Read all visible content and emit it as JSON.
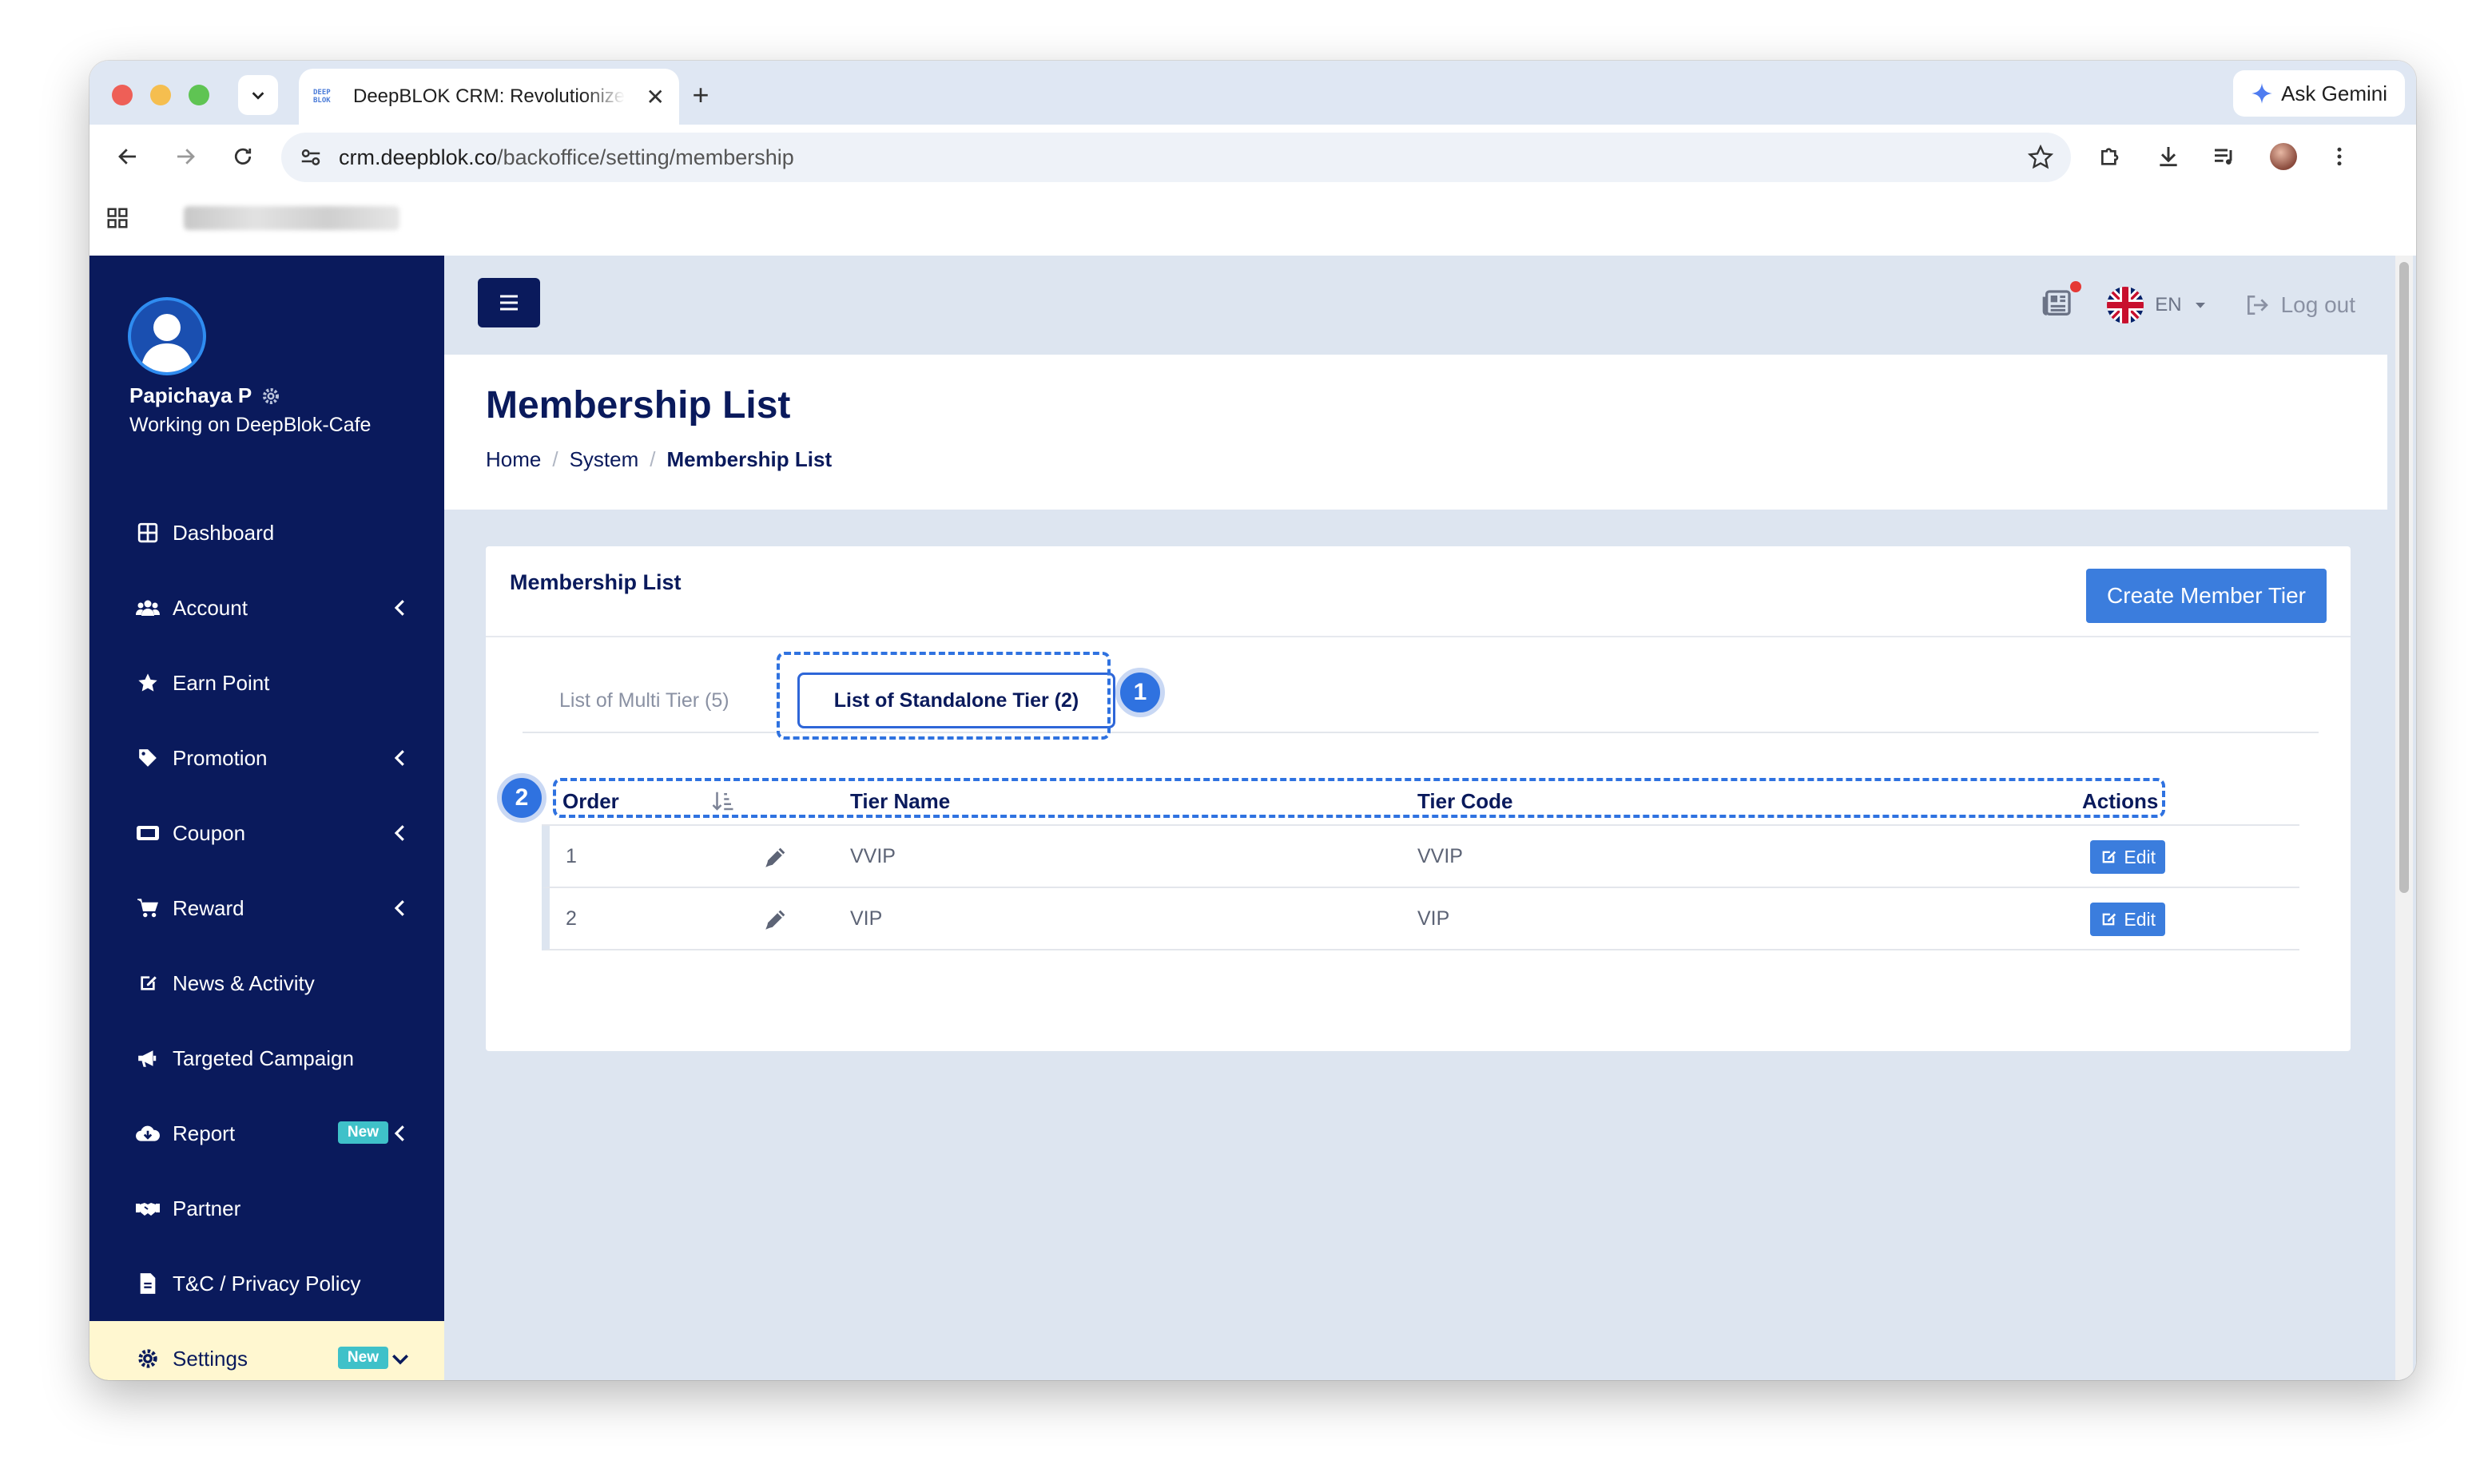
{
  "browser": {
    "tab_title": "DeepBLOK CRM: Revolutionize",
    "favicon_text_1": "DEEP",
    "favicon_text_2": "BLOK",
    "ask_gemini": "Ask Gemini",
    "url_host": "crm.deepblok.co",
    "url_path": "/backoffice/setting/membership"
  },
  "sidebar": {
    "user_name": "Papichaya P",
    "user_sub": "Working on DeepBlok-Cafe",
    "items": [
      {
        "label": "Dashboard",
        "icon": "dashboard-icon",
        "chevron": false
      },
      {
        "label": "Account",
        "icon": "users-icon",
        "chevron": true
      },
      {
        "label": "Earn Point",
        "icon": "star-icon",
        "chevron": false
      },
      {
        "label": "Promotion",
        "icon": "tag-icon",
        "chevron": true
      },
      {
        "label": "Coupon",
        "icon": "ticket-icon",
        "chevron": true
      },
      {
        "label": "Reward",
        "icon": "cart-icon",
        "chevron": true
      },
      {
        "label": "News & Activity",
        "icon": "edit-icon",
        "chevron": false
      },
      {
        "label": "Targeted Campaign",
        "icon": "megaphone-icon",
        "chevron": false
      },
      {
        "label": "Report",
        "icon": "cloud-download-icon",
        "chevron": true,
        "badge": "New"
      },
      {
        "label": "Partner",
        "icon": "handshake-icon",
        "chevron": false
      },
      {
        "label": "T&C / Privacy Policy",
        "icon": "file-icon",
        "chevron": false
      },
      {
        "label": "Settings",
        "icon": "gear-icon",
        "chevron": true,
        "badge": "New",
        "active": true
      }
    ]
  },
  "topbar": {
    "language": "EN",
    "logout": "Log out"
  },
  "page": {
    "title": "Membership List",
    "breadcrumb": [
      "Home",
      "System",
      "Membership List"
    ]
  },
  "card": {
    "title": "Membership List",
    "create_button": "Create Member Tier",
    "tabs": [
      "List of Multi Tier (5)",
      "List of Standalone Tier (2)"
    ],
    "annotation_1": "1",
    "annotation_2": "2"
  },
  "table": {
    "headers": {
      "order": "Order",
      "tier_name": "Tier Name",
      "tier_code": "Tier Code",
      "actions": "Actions"
    },
    "rows": [
      {
        "order": "1",
        "tier_name": "VVIP",
        "tier_code": "VVIP",
        "action": "Edit"
      },
      {
        "order": "2",
        "tier_name": "VIP",
        "tier_code": "VIP",
        "action": "Edit"
      }
    ]
  }
}
